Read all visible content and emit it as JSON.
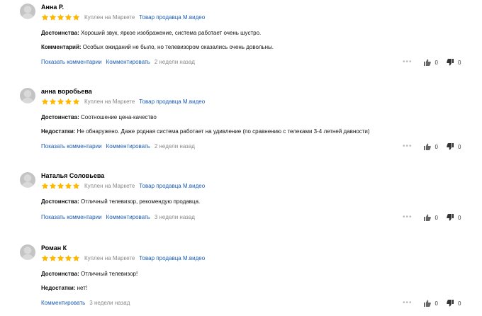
{
  "reviews": [
    {
      "author": "Анна Р.",
      "rating": 5,
      "bought": "Куплен на Маркете",
      "seller": "Товар продавца М.видео",
      "lines": [
        {
          "label": "Достоинства:",
          "text": "Хороший звук, яркое изображение, система работает очень шустро."
        },
        {
          "label": "Комментарий:",
          "text": "Особых ожиданий не было, но телевизором оказались очень довольны."
        }
      ],
      "show_comments": "Показать комментарии",
      "comment": "Комментировать",
      "time": "2 недели назад",
      "likes": "0",
      "dislikes": "0"
    },
    {
      "author": "анна воробьева",
      "rating": 5,
      "bought": "Куплен на Маркете",
      "seller": "Товар продавца М.видео",
      "lines": [
        {
          "label": "Достоинства:",
          "text": "Соотношение цена-качество"
        },
        {
          "label": "Недостатки:",
          "text": "Не обнаружено. Даже родная система работает на удивление (по сравнению с телеками 3-4 летней давности)"
        }
      ],
      "show_comments": "Показать комментарии",
      "comment": "Комментировать",
      "time": "2 недели назад",
      "likes": "0",
      "dislikes": "0"
    },
    {
      "author": "Наталья Соловьева",
      "rating": 5,
      "bought": "Куплен на Маркете",
      "seller": "Товар продавца М.видео",
      "lines": [
        {
          "label": "Достоинства:",
          "text": "Отличный телевизор, рекомендую продавца."
        }
      ],
      "show_comments": "Показать комментарии",
      "comment": "Комментировать",
      "time": "3 недели назад",
      "likes": "0",
      "dislikes": "0"
    },
    {
      "author": "Роман К",
      "rating": 5,
      "bought": "Куплен на Маркете",
      "seller": "Товар продавца М.видео",
      "lines": [
        {
          "label": "Достоинства:",
          "text": "Отличный телевизор!"
        },
        {
          "label": "Недостатки:",
          "text": "нет!"
        }
      ],
      "show_comments": "",
      "comment": "Комментировать",
      "time": "3 недели назад",
      "likes": "0",
      "dislikes": "0"
    }
  ],
  "colors": {
    "star": "#ffb800",
    "link": "#1a5bb5",
    "muted": "#888888"
  },
  "icons": [
    "user-avatar-icon",
    "star-icon",
    "more-dots-icon",
    "thumbs-up-icon",
    "thumbs-down-icon"
  ]
}
